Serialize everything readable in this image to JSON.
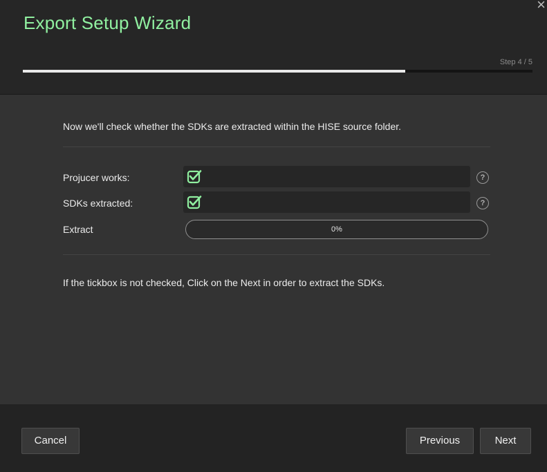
{
  "header": {
    "title": "Export Setup Wizard",
    "close_icon": "×",
    "step_label": "Step 4 / 5",
    "progress_fraction": 0.75
  },
  "content": {
    "intro": "Now we'll check whether the SDKs are extracted within the HISE source folder.",
    "rows": [
      {
        "label": "Projucer works:",
        "checked": true,
        "help": "?"
      },
      {
        "label": "SDKs extracted:",
        "checked": true,
        "help": "?"
      }
    ],
    "extract": {
      "label": "Extract",
      "value_text": "0%",
      "progress": 0
    },
    "hint": "If the tickbox is not checked, Click on the Next in order to extract the SDKs."
  },
  "footer": {
    "cancel_label": "Cancel",
    "previous_label": "Previous",
    "next_label": "Next"
  },
  "colors": {
    "accent": "#90f0a0",
    "background": "#333333",
    "header_bg": "#262626"
  }
}
